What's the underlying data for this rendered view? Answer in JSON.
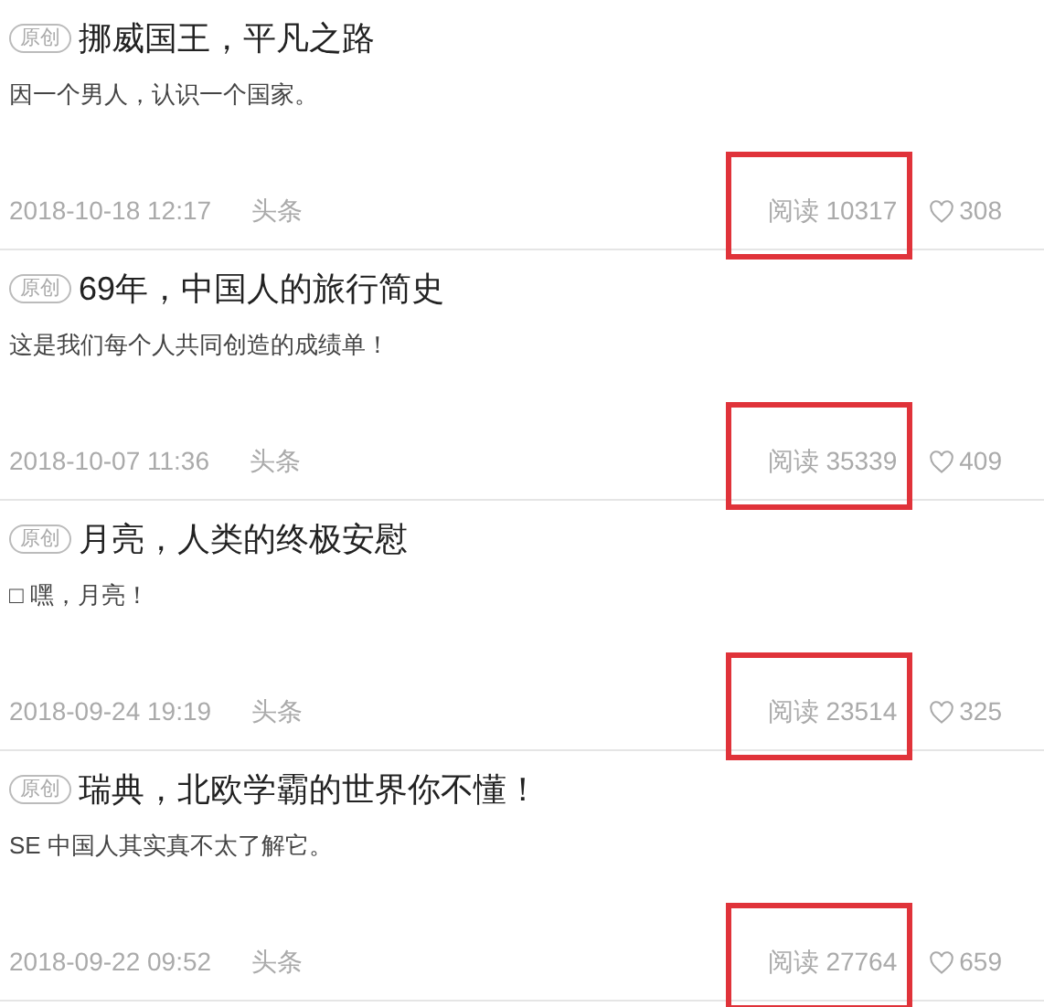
{
  "articles": [
    {
      "badge": "原创",
      "title": "挪威国王，平凡之路",
      "summary": "因一个男人，认识一个国家。",
      "date": "2018-10-18 12:17",
      "source": "头条",
      "reads": "阅读 10317",
      "likes": "308",
      "highlighted": true
    },
    {
      "badge": "原创",
      "title": "69年，中国人的旅行简史",
      "summary": "这是我们每个人共同创造的成绩单！",
      "date": "2018-10-07 11:36",
      "source": "头条",
      "reads": "阅读 35339",
      "likes": "409",
      "highlighted": true
    },
    {
      "badge": "原创",
      "title": "月亮，人类的终极安慰",
      "summary": "□ 嘿，月亮！",
      "date": "2018-09-24 19:19",
      "source": "头条",
      "reads": "阅读 23514",
      "likes": "325",
      "highlighted": true
    },
    {
      "badge": "原创",
      "title": "瑞典，北欧学霸的世界你不懂！",
      "summary": "SE 中国人其实真不太了解它。",
      "date": "2018-09-22 09:52",
      "source": "头条",
      "reads": "阅读 27764",
      "likes": "659",
      "highlighted": true
    }
  ]
}
